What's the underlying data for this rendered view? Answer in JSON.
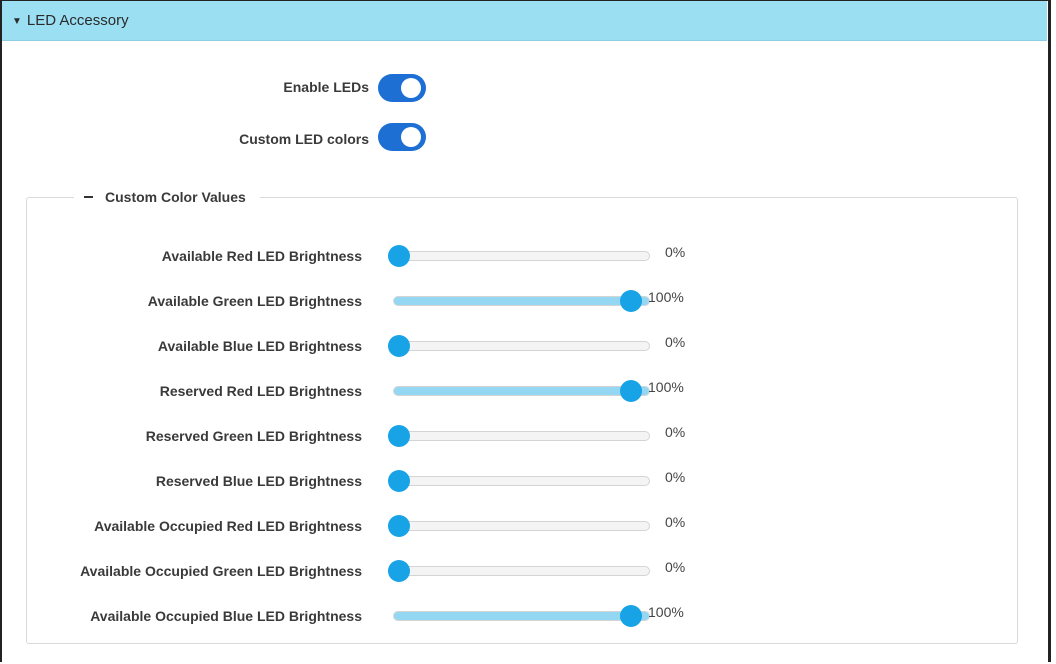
{
  "section": {
    "title": "LED Accessory",
    "caret_icon": "caret-down-icon"
  },
  "toggles": [
    {
      "label": "Enable LEDs",
      "on": true
    },
    {
      "label": "Custom LED colors",
      "on": true
    }
  ],
  "custom_colors": {
    "legend": "Custom Color Values",
    "collapse_icon": "minus-icon",
    "sliders": [
      {
        "label": "Available Red LED Brightness",
        "percent": 0,
        "value_text": "0%"
      },
      {
        "label": "Available Green LED Brightness",
        "percent": 100,
        "value_text": "100%"
      },
      {
        "label": "Available Blue LED Brightness",
        "percent": 0,
        "value_text": "0%"
      },
      {
        "label": "Reserved Red LED Brightness",
        "percent": 100,
        "value_text": "100%"
      },
      {
        "label": "Reserved Green LED Brightness",
        "percent": 0,
        "value_text": "0%"
      },
      {
        "label": "Reserved Blue LED Brightness",
        "percent": 0,
        "value_text": "0%"
      },
      {
        "label": "Available Occupied Red LED Brightness",
        "percent": 0,
        "value_text": "0%"
      },
      {
        "label": "Available Occupied Green LED Brightness",
        "percent": 0,
        "value_text": "0%"
      },
      {
        "label": "Available Occupied Blue LED Brightness",
        "percent": 100,
        "value_text": "100%"
      }
    ]
  },
  "colors": {
    "header_bg": "#9bdff3",
    "toggle_on": "#1d6fd3",
    "slider_thumb": "#17a3e6",
    "slider_fill": "#93d7f2"
  }
}
